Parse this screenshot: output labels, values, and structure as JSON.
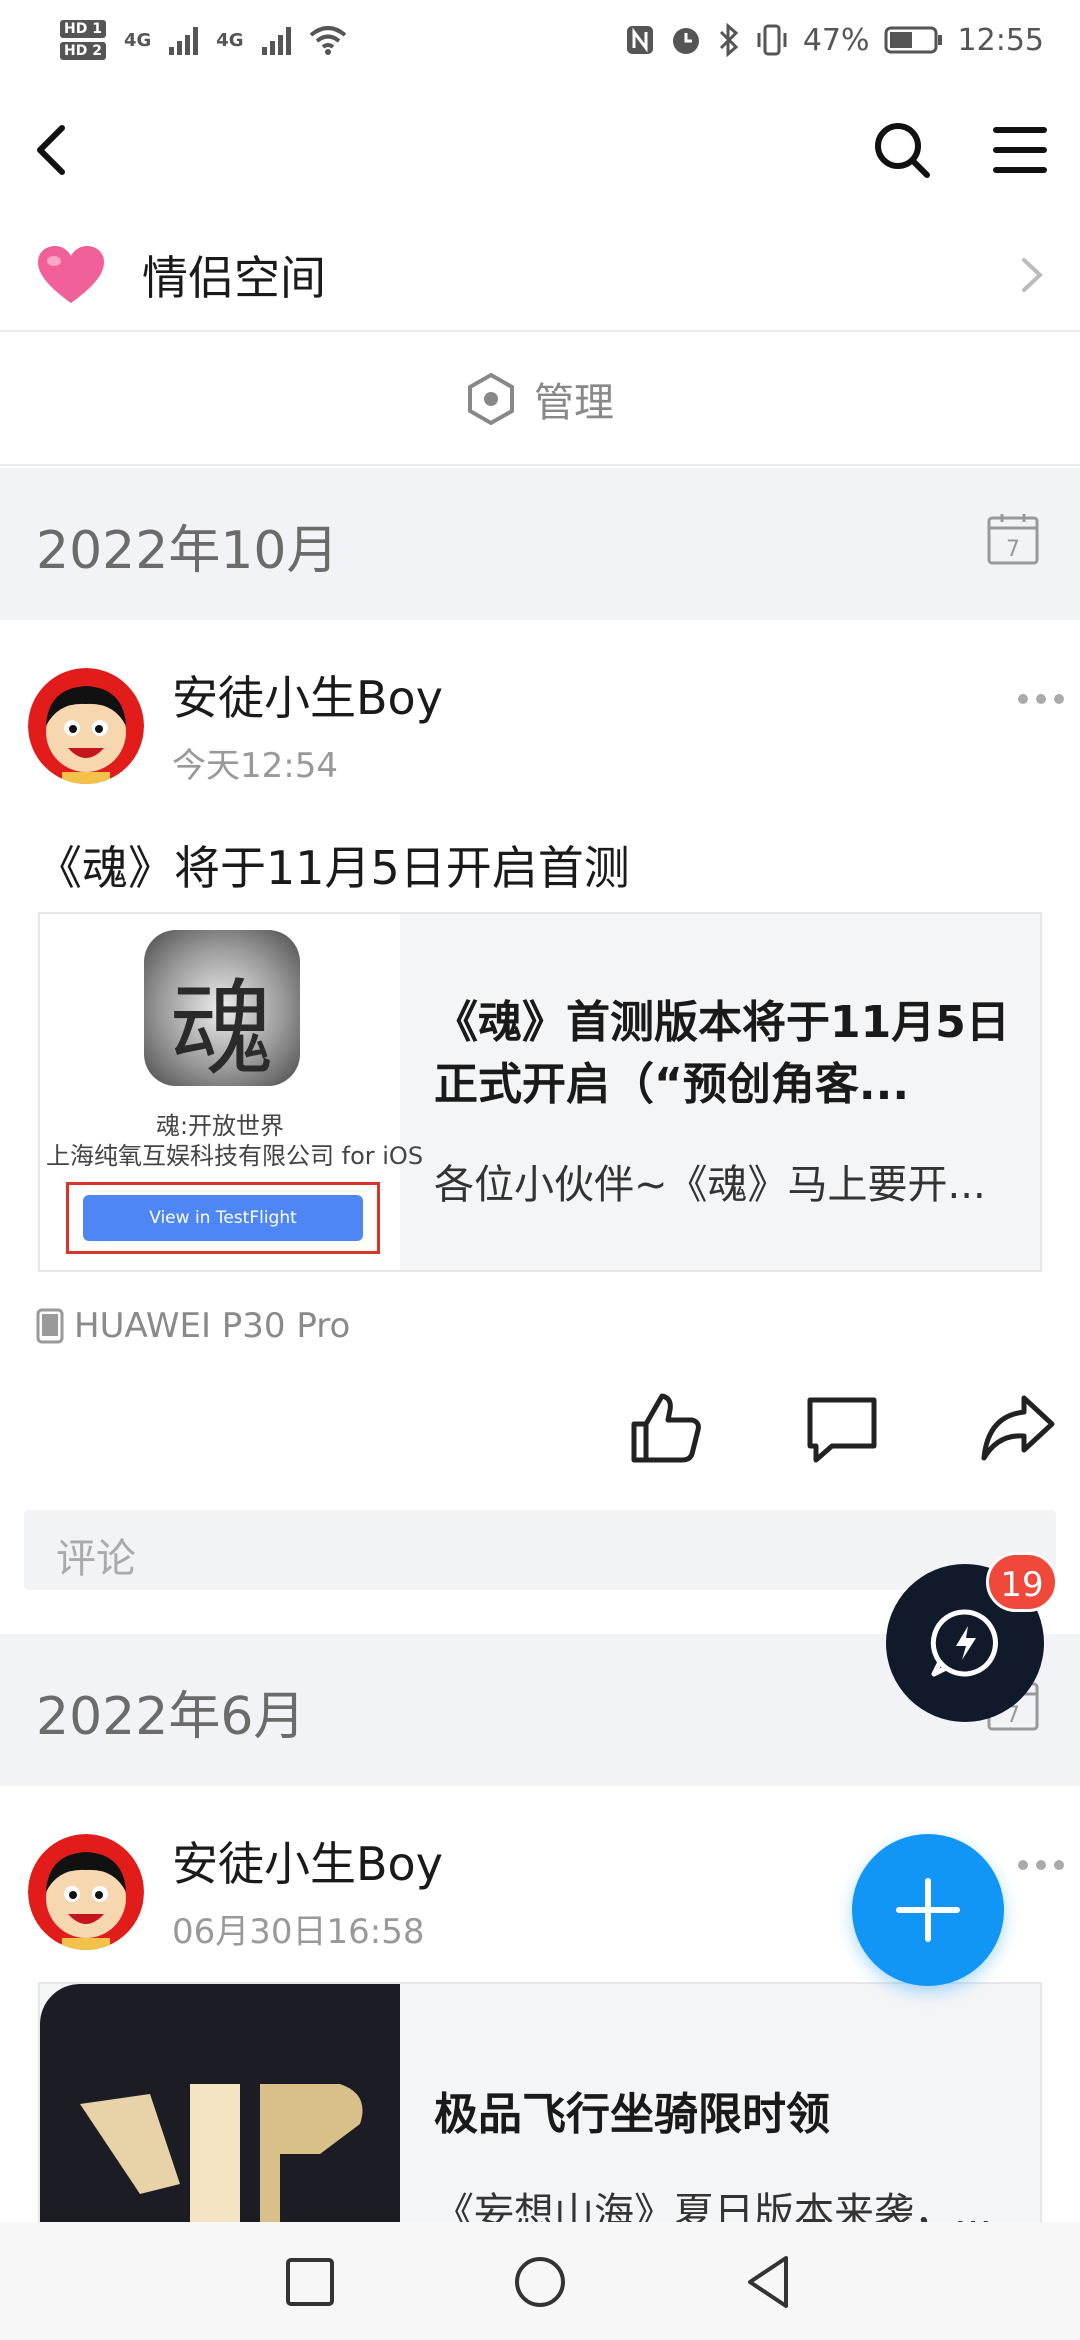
{
  "status_bar": {
    "hd1": "HD 1",
    "hd2": "HD 2",
    "net1": "4G",
    "net2": "4G",
    "battery": "47%",
    "time": "12:55"
  },
  "couple_space": {
    "label": "情侣空间"
  },
  "manage": {
    "label": "管理"
  },
  "sections": [
    {
      "month": "2022年10月",
      "post": {
        "author": "安徒小生Boy",
        "time": "今天12:54",
        "text": "《魂》将于11月5日开启首测",
        "card": {
          "title": "《魂》首测版本将于11月5日正式开启（“预创角客...",
          "desc": "各位小伙伴~《魂》马上要开...",
          "app_glyph": "魂",
          "app_name": "魂:开放世界",
          "app_company": "上海纯氧互娱科技有限公司 for iOS",
          "testflight": "View in TestFlight"
        },
        "device": "HUAWEI P30 Pro",
        "comment_placeholder": "评论"
      }
    },
    {
      "month": "2022年6月",
      "post": {
        "author": "安徒小生Boy",
        "time": "06月30日16:58",
        "card": {
          "title": "极品飞行坐骑限时领",
          "desc": "《妄想山海》夏日版本来袭，..."
        }
      }
    }
  ],
  "quick_badge": "19",
  "colors": {
    "accent_blue": "#1296f6",
    "badge_red": "#f0483a",
    "section_bg": "#f1f3f6",
    "heart_pink": "#f2609a"
  },
  "icons": [
    "back-icon",
    "search-icon",
    "menu-icon",
    "heart-icon",
    "chevron-right-icon",
    "manage-icon",
    "calendar-icon",
    "more-icon",
    "phone-icon",
    "like-icon",
    "comment-icon",
    "share-icon",
    "quick-reply-icon",
    "plus-icon",
    "recent-apps-icon",
    "home-icon",
    "back-nav-icon"
  ]
}
